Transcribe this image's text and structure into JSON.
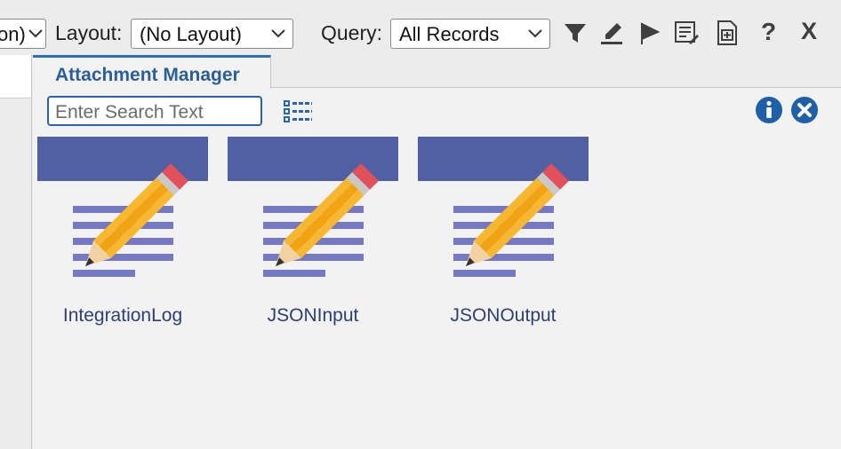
{
  "toolbar": {
    "prev_select_value": "on)",
    "layout_label": "Layout:",
    "layout_value": "(No Layout)",
    "query_label": "Query:",
    "query_value": "All Records",
    "icons": [
      "filter-icon",
      "eraser-icon",
      "run-icon",
      "edit-list-icon",
      "add-document-icon",
      "help-icon",
      "close-icon"
    ],
    "help_glyph": "?",
    "close_glyph": "X"
  },
  "tab": {
    "label": "Attachment Manager"
  },
  "search": {
    "placeholder": "Enter Search Text",
    "value": ""
  },
  "attachments": [
    {
      "name": "IntegrationLog"
    },
    {
      "name": "JSONInput"
    },
    {
      "name": "JSONOutput"
    }
  ],
  "colors": {
    "accent": "#2c6fc2",
    "tile_header": "#5160a3",
    "icon_blue": "#1f5fa8",
    "tab_text": "#2c5f95"
  }
}
